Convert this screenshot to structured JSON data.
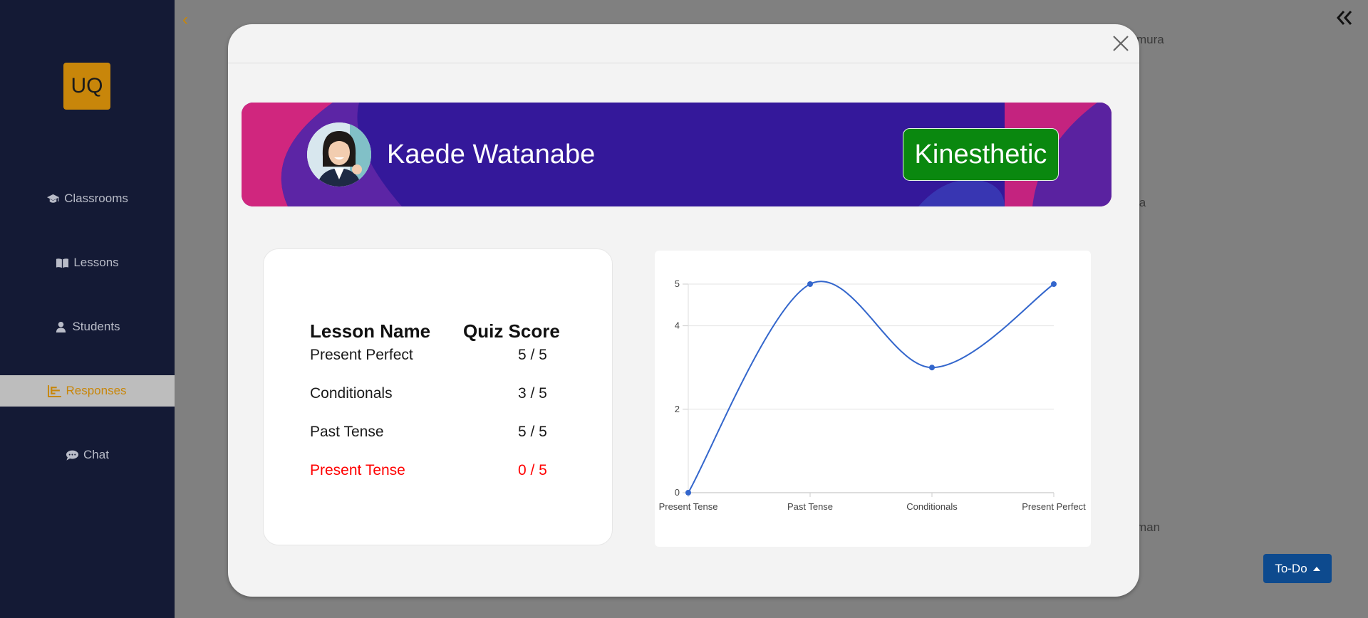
{
  "logo": {
    "text": "UQ",
    "color": "#c8860a"
  },
  "sidebar": {
    "items": [
      {
        "label": "Classrooms",
        "icon": "graduation-cap-icon"
      },
      {
        "label": "Lessons",
        "icon": "book-open-icon"
      },
      {
        "label": "Students",
        "icon": "user-icon"
      },
      {
        "label": "Responses",
        "icon": "bar-chart-icon",
        "active": true
      },
      {
        "label": "Chat",
        "icon": "chat-bubble-icon"
      }
    ]
  },
  "background": {
    "text1": "mura",
    "text2": "ia",
    "text3": "man"
  },
  "todo": {
    "label": "To-Do"
  },
  "modal": {
    "student_name": "Kaede Watanabe",
    "learning_style": "Kinesthetic",
    "table": {
      "headers": [
        "Lesson Name",
        "Quiz Score"
      ],
      "rows": [
        {
          "lesson": "Present Perfect",
          "score": "5 / 5"
        },
        {
          "lesson": "Conditionals",
          "score": "3 / 5"
        },
        {
          "lesson": "Past Tense",
          "score": "5 / 5"
        },
        {
          "lesson": "Present Tense",
          "score": "0 / 5"
        }
      ]
    }
  },
  "colors": {
    "accent": "#c8860a",
    "badge": "#0a880f",
    "fail": "#ff0000",
    "line": "#3366cc"
  },
  "chart_data": {
    "type": "line",
    "categories": [
      "Present Tense",
      "Past Tense",
      "Conditionals",
      "Present Perfect"
    ],
    "series": [
      {
        "values": [
          0,
          5,
          3,
          5
        ]
      }
    ],
    "ylim": [
      0,
      5
    ],
    "yticks": [
      0,
      2,
      4,
      5
    ],
    "smooth": true,
    "grid": true
  }
}
